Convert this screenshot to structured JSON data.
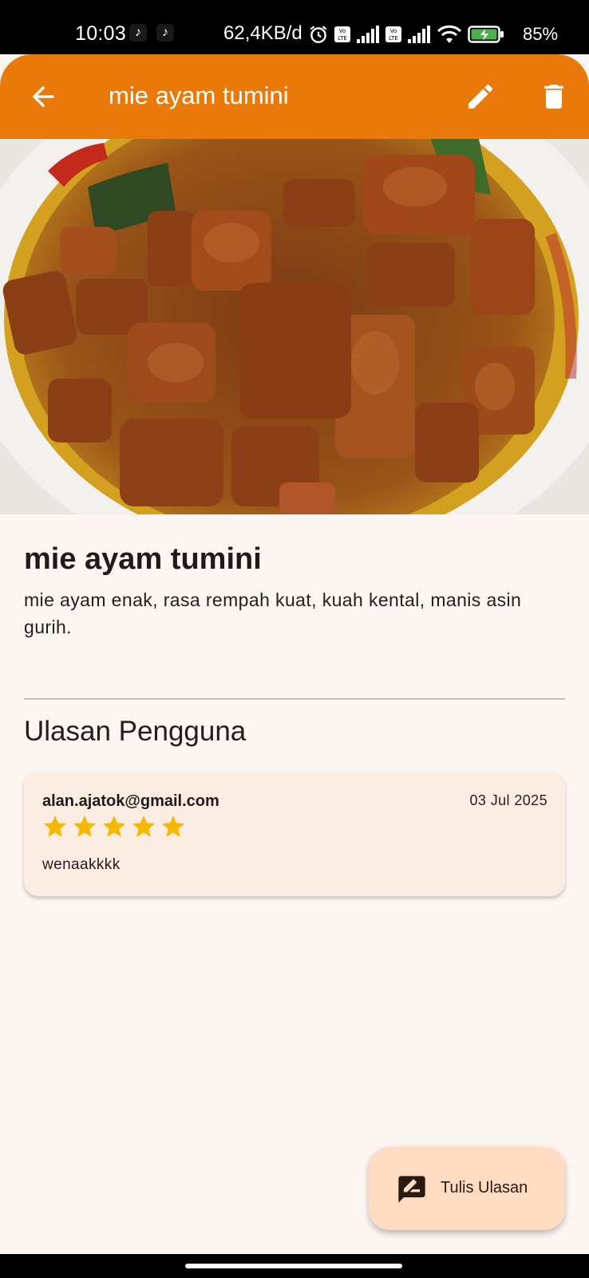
{
  "status_bar": {
    "time": "10:03",
    "network_speed": "62,4KB/d",
    "volte_1": "Vo LTE",
    "volte_2": "Vo LTE",
    "battery_percent": "85%"
  },
  "app_bar": {
    "title": "mie ayam tumini",
    "back_icon": "arrow-back-icon",
    "edit_icon": "pencil-icon",
    "delete_icon": "trash-icon"
  },
  "detail": {
    "name": "mie ayam tumini",
    "description": "mie ayam enak, rasa rempah kuat, kuah kental, manis asin gurih."
  },
  "reviews": {
    "section_title": "Ulasan Pengguna",
    "items": [
      {
        "email": "alan.ajatok@gmail.com",
        "date": "03 Jul 2025",
        "rating": 5,
        "max_rating": 5,
        "text": "wenaakkkk"
      }
    ]
  },
  "fab": {
    "label": "Tulis Ulasan",
    "icon": "rate-review-icon"
  },
  "colors": {
    "app_bar": "#e97a0a",
    "background": "#fdf5f2",
    "card": "#fcede3",
    "fab": "#ffdbc2",
    "star": "#f5b800"
  }
}
